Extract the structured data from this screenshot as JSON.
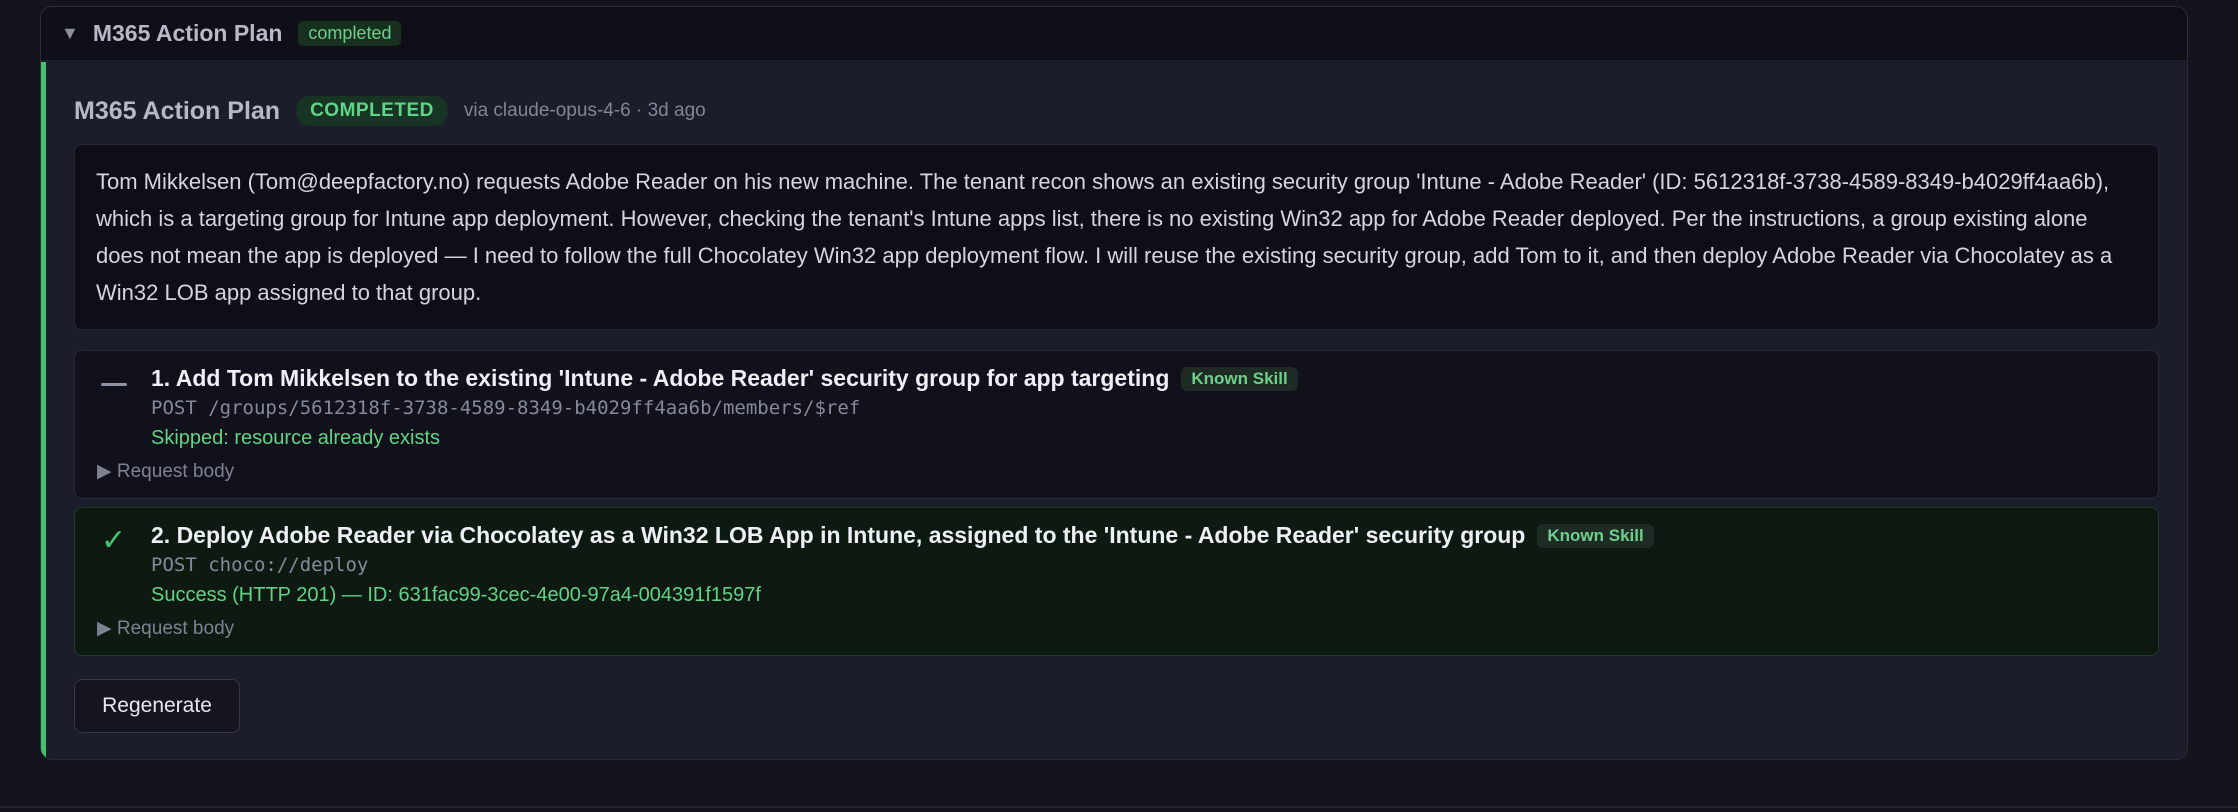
{
  "header": {
    "collapse_glyph": "▼",
    "title": "M365 Action Plan",
    "status": "completed"
  },
  "plan": {
    "title": "M365 Action Plan",
    "status": "COMPLETED",
    "meta": "via claude-opus-4-6 · 3d ago",
    "reasoning": "Tom Mikkelsen (Tom@deepfactory.no) requests Adobe Reader on his new machine. The tenant recon shows an existing security group 'Intune - Adobe Reader' (ID: 5612318f-3738-4589-8349-b4029ff4aa6b), which is a targeting group for Intune app deployment. However, checking the tenant's Intune apps list, there is no existing Win32 app for Adobe Reader deployed. Per the instructions, a group existing alone does not mean the app is deployed — I need to follow the full Chocolatey Win32 app deployment flow. I will reuse the existing security group, add Tom to it, and then deploy Adobe Reader via Chocolatey as a Win32 LOB app assigned to that group."
  },
  "steps": [
    {
      "title": "1. Add Tom Mikkelsen to the existing 'Intune - Adobe Reader' security group for app targeting",
      "badge": "Known Skill",
      "endpoint": "POST /groups/5612318f-3738-4589-8349-b4029ff4aa6b/members/$ref",
      "result": "Skipped: resource already exists",
      "request_body_label": "▶ Request body",
      "state_icon": "dash-icon"
    },
    {
      "title": "2. Deploy Adobe Reader via Chocolatey as a Win32 LOB App in Intune, assigned to the 'Intune - Adobe Reader' security group",
      "badge": "Known Skill",
      "endpoint": "POST choco://deploy",
      "result": "Success (HTTP 201) — ID: 631fac99-3cec-4e00-97a4-004391f1597f",
      "request_body_label": "▶ Request body",
      "state_icon": "checkmark-icon",
      "check_glyph": "✓"
    }
  ],
  "actions": {
    "regenerate_label": "Regenerate"
  },
  "colors": {
    "accent_green": "#45c06c",
    "background": "#13141c",
    "panel": "#1b1d2b"
  }
}
